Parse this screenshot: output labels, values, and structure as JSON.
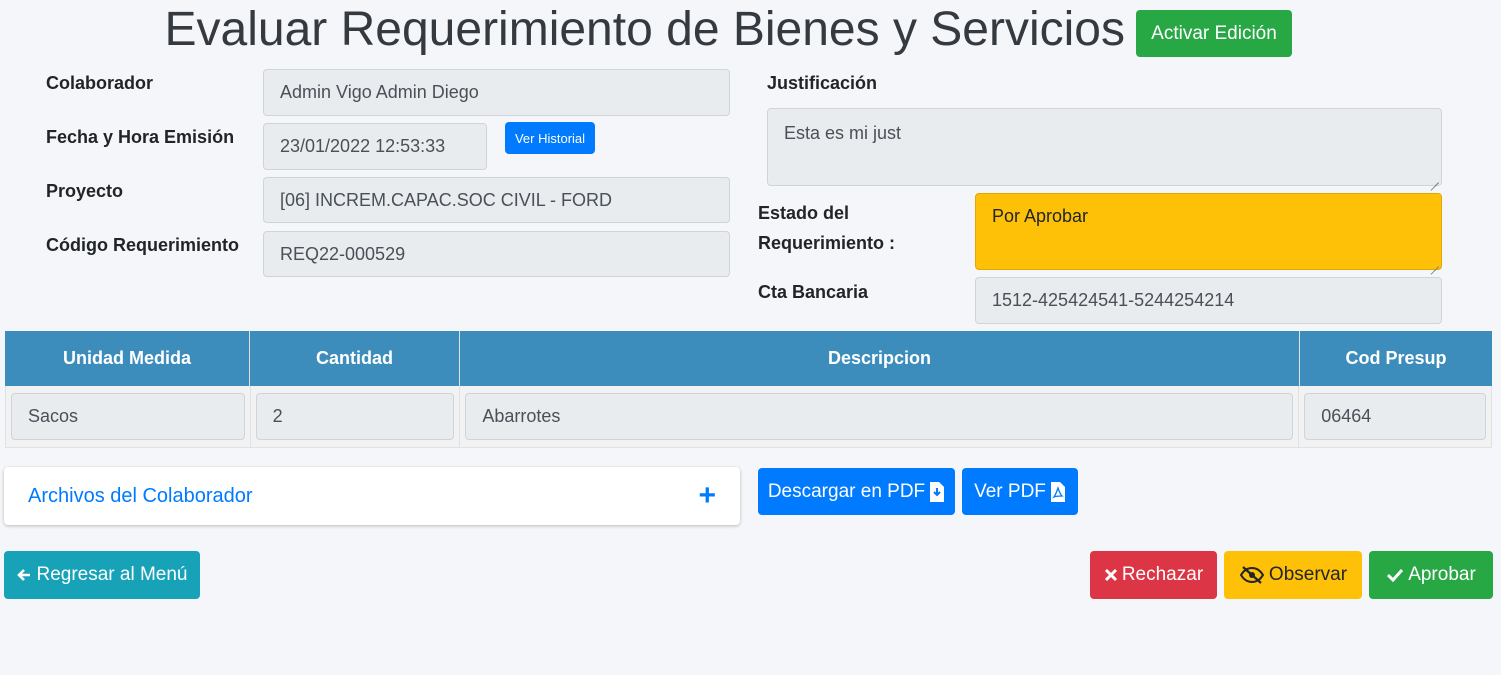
{
  "header": {
    "title": "Evaluar Requerimiento de Bienes y Servicios",
    "activar_label": "Activar Edición"
  },
  "form": {
    "colaborador_label": "Colaborador",
    "colaborador_value": "Admin Vigo Admin Diego",
    "fecha_label": "Fecha y Hora Emisión",
    "fecha_value": "23/01/2022 12:53:33",
    "ver_historial_label": "Ver Historial",
    "proyecto_label": "Proyecto",
    "proyecto_value": "[06] INCREM.CAPAC.SOC CIVIL - FORD",
    "codigo_label": "Código Requerimiento",
    "codigo_value": "REQ22-000529",
    "justificacion_label": "Justificación",
    "justificacion_value": "Esta es mi just",
    "estado_label_line1": "Estado del",
    "estado_label_line2": "Requerimiento :",
    "estado_value": "Por Aprobar",
    "cta_label": "Cta Bancaria",
    "cta_value": "1512-425424541-5244254214"
  },
  "table": {
    "headers": [
      "Unidad Medida",
      "Cantidad",
      "Descripcion",
      "Cod Presup"
    ],
    "rows": [
      [
        "Sacos",
        "2",
        "Abarrotes",
        "06464"
      ]
    ]
  },
  "archivos": {
    "title": "Archivos del Colaborador",
    "toggle": "+"
  },
  "buttons": {
    "descargar_pdf": "Descargar en PDF",
    "ver_pdf": "Ver PDF",
    "regresar": "Regresar al Menú",
    "rechazar": "Rechazar",
    "observar": "Observar",
    "aprobar": "Aprobar"
  },
  "colors": {
    "primary": "#007bff",
    "success": "#28a745",
    "danger": "#dc3545",
    "warning": "#ffc107",
    "info": "#17a2b8",
    "table_header": "#3c8dbc"
  }
}
